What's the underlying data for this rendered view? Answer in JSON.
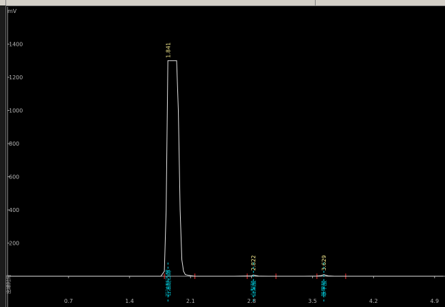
{
  "chart_data": {
    "type": "line",
    "title": "",
    "ylabel": "mV",
    "xlabel": "",
    "y_axis_side_label": "出峰时间",
    "xlim": [
      0,
      5.0
    ],
    "ylim": [
      -40,
      1480
    ],
    "x_ticks": [
      "0.7",
      "1.4",
      "2.1",
      "2.8",
      "3.5",
      "4.2",
      "4.9"
    ],
    "y_ticks": [
      "200",
      "400",
      "600",
      "800",
      "1000",
      "1200",
      "1400"
    ],
    "grid": false,
    "series": [
      {
        "x": [
          0.0,
          1.76,
          1.8,
          1.82,
          1.84,
          1.9,
          1.94,
          1.96,
          1.98,
          2.0,
          2.02,
          2.04,
          2.08,
          2.15,
          2.25,
          2.6,
          2.8,
          2.82,
          2.85,
          2.88,
          3.0,
          3.4,
          3.55,
          3.6,
          3.63,
          3.65,
          3.68,
          3.75,
          4.5,
          5.0
        ],
        "y": [
          0,
          0,
          30,
          400,
          1300,
          1300,
          1300,
          1000,
          400,
          100,
          30,
          10,
          5,
          0,
          0,
          0,
          2,
          8,
          4,
          1,
          0,
          0,
          1,
          4,
          10,
          6,
          2,
          0,
          0,
          0
        ]
      }
    ],
    "peaks": [
      {
        "retention_time": 1.841,
        "time_label": "1.841",
        "name": "石油醚乙醇"
      },
      {
        "retention_time": 2.822,
        "time_label": "2.822",
        "name": "山梨酸"
      },
      {
        "retention_time": 3.629,
        "time_label": "3.629",
        "name": "苯甲酸"
      }
    ],
    "integration_marks": [
      1.8,
      2.15,
      2.75,
      3.08,
      3.55,
      3.88
    ],
    "colors": {
      "background": "#000000",
      "trace": "#e6e6e6",
      "axis": "#a0a0a0",
      "tick_label": "#b4b4b4",
      "peak_time_label": "#f0e68c",
      "peak_name_label": "#00d0e0",
      "integration_mark": "#ff3030",
      "top_strip": "#d4d0c8"
    }
  }
}
